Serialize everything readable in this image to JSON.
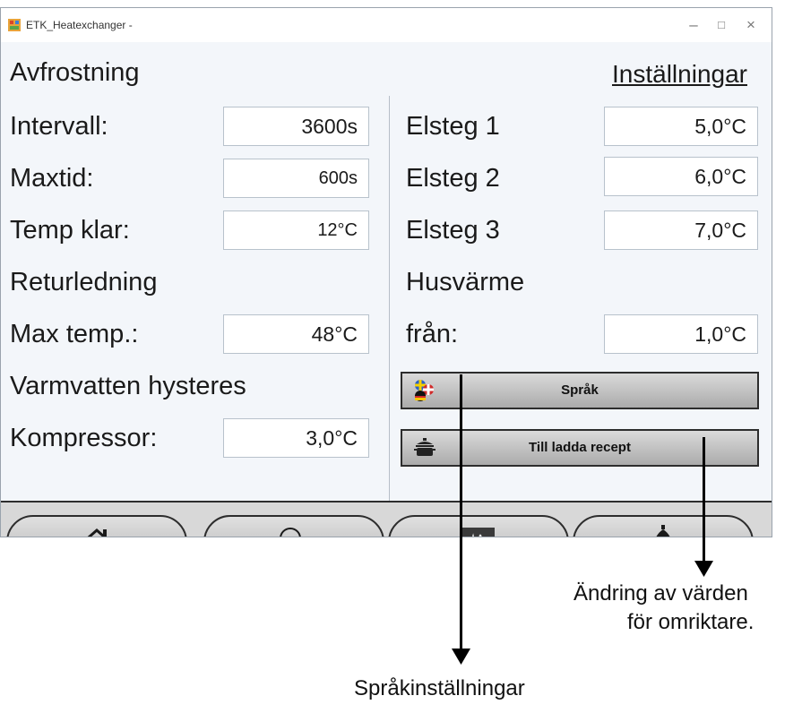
{
  "window": {
    "title": "ETK_Heatexchanger -",
    "minimize": "–",
    "maximize": "□",
    "close": "×"
  },
  "left": {
    "section_defrost": "Avfrostning",
    "interval_label": "Intervall:",
    "interval_value": "3600s",
    "maxtime_label": "Maxtid:",
    "maxtime_value": "600s",
    "tempready_label": "Temp klar:",
    "tempready_value": "12°C",
    "section_return": "Returledning",
    "maxtemp_label": "Max temp.:",
    "maxtemp_value": "48°C",
    "section_hotwater": "Varmvatten hysteres",
    "compressor_label": "Kompressor:",
    "compressor_value": "3,0°C"
  },
  "right": {
    "settings_link": "Inställningar",
    "elsteg1_label": "Elsteg 1",
    "elsteg1_value": "5,0°C",
    "elsteg2_label": "Elsteg 2",
    "elsteg2_value": "6,0°C",
    "elsteg3_label": "Elsteg 3",
    "elsteg3_value": "7,0°C",
    "section_house": "Husvärme",
    "from_label": "från:",
    "from_value": "1,0°C",
    "language_button": "Språk",
    "recipe_button": "Till ladda recept"
  },
  "nav": {
    "icons": [
      "home-icon",
      "search-icon",
      "trend-icon",
      "bell-icon"
    ]
  },
  "annotations": {
    "inverter": [
      "Ändring av värden",
      "för omriktare."
    ],
    "language": "Språkinställningar"
  }
}
